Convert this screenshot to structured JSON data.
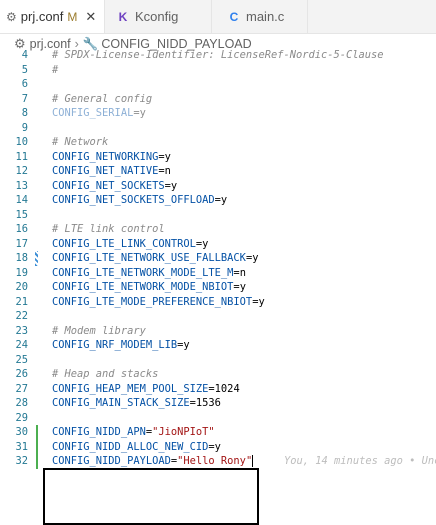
{
  "tabs": [
    {
      "label": "prj.conf",
      "modified": "M",
      "close": "✕",
      "icon": "gear-icon",
      "active": true
    },
    {
      "label": "Kconfig",
      "icon": "kconfig-icon",
      "active": false
    },
    {
      "label": "main.c",
      "icon": "c-icon",
      "active": false
    }
  ],
  "breadcrumb": {
    "file": "prj.conf",
    "symbol": "CONFIG_NIDD_PAYLOAD"
  },
  "lines": [
    {
      "n": "4",
      "type": "comment",
      "text": "# SPDX-License-Identifier: LicenseRef-Nordic-5-Clause"
    },
    {
      "n": "5",
      "type": "comment",
      "text": "#"
    },
    {
      "n": "6",
      "type": "blank",
      "text": ""
    },
    {
      "n": "7",
      "type": "comment",
      "text": "# General config"
    },
    {
      "n": "8",
      "type": "faded",
      "key": "CONFIG_SERIAL",
      "val": "y"
    },
    {
      "n": "9",
      "type": "blank",
      "text": ""
    },
    {
      "n": "10",
      "type": "comment",
      "text": "# Network"
    },
    {
      "n": "11",
      "type": "kv",
      "key": "CONFIG_NETWORKING",
      "val": "y"
    },
    {
      "n": "12",
      "type": "kv",
      "key": "CONFIG_NET_NATIVE",
      "val": "n"
    },
    {
      "n": "13",
      "type": "kv",
      "key": "CONFIG_NET_SOCKETS",
      "val": "y"
    },
    {
      "n": "14",
      "type": "kv",
      "key": "CONFIG_NET_SOCKETS_OFFLOAD",
      "val": "y"
    },
    {
      "n": "15",
      "type": "blank",
      "text": ""
    },
    {
      "n": "16",
      "type": "comment",
      "text": "# LTE link control"
    },
    {
      "n": "17",
      "type": "kv",
      "key": "CONFIG_LTE_LINK_CONTROL",
      "val": "y"
    },
    {
      "n": "18",
      "type": "kv",
      "key": "CONFIG_LTE_NETWORK_USE_FALLBACK",
      "val": "y"
    },
    {
      "n": "19",
      "type": "kv",
      "key": "CONFIG_LTE_NETWORK_MODE_LTE_M",
      "val": "n"
    },
    {
      "n": "20",
      "type": "kv",
      "key": "CONFIG_LTE_NETWORK_MODE_NBIOT",
      "val": "y"
    },
    {
      "n": "21",
      "type": "kv",
      "key": "CONFIG_LTE_MODE_PREFERENCE_NBIOT",
      "val": "y"
    },
    {
      "n": "22",
      "type": "blank",
      "text": ""
    },
    {
      "n": "23",
      "type": "comment",
      "text": "# Modem library"
    },
    {
      "n": "24",
      "type": "kv",
      "key": "CONFIG_NRF_MODEM_LIB",
      "val": "y"
    },
    {
      "n": "25",
      "type": "blank",
      "text": ""
    },
    {
      "n": "26",
      "type": "comment",
      "text": "# Heap and stacks"
    },
    {
      "n": "27",
      "type": "kv",
      "key": "CONFIG_HEAP_MEM_POOL_SIZE",
      "val": "1024"
    },
    {
      "n": "28",
      "type": "kv",
      "key": "CONFIG_MAIN_STACK_SIZE",
      "val": "1536"
    },
    {
      "n": "29",
      "type": "blank",
      "text": ""
    },
    {
      "n": "30",
      "type": "kv",
      "key": "CONFIG_NIDD_APN",
      "val": "\"JioNPIoT\""
    },
    {
      "n": "31",
      "type": "kv",
      "key": "CONFIG_NIDD_ALLOC_NEW_CID",
      "val": "y"
    },
    {
      "n": "32",
      "type": "kv",
      "key": "CONFIG_NIDD_PAYLOAD",
      "val": "\"Hello Rony\""
    }
  ],
  "blame": "You, 14 minutes ago • Unc"
}
